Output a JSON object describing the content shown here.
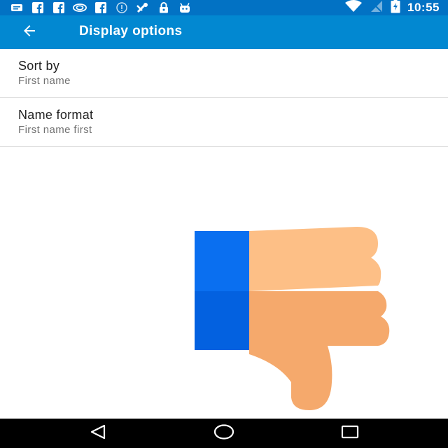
{
  "status_bar": {
    "time": "10:55",
    "left_icons": [
      "message-icon",
      "facebook-icon",
      "facebook-icon",
      "nvidia-icon",
      "facebook-icon",
      "info-icon",
      "no-sign-icon",
      "lock-icon",
      "android-icon"
    ],
    "right_icons": [
      "wifi-icon",
      "signal-icon",
      "battery-charging-icon"
    ]
  },
  "app_bar": {
    "title": "Display options",
    "back_icon": "arrow-back-icon"
  },
  "settings": [
    {
      "title": "Sort by",
      "summary": "First name"
    },
    {
      "title": "Name format",
      "summary": "First name first"
    }
  ],
  "overlay": {
    "icon": "thumbs-down-icon"
  },
  "nav_bar": {
    "icons": [
      "back-triangle-icon",
      "home-circle-icon",
      "recents-square-icon"
    ]
  },
  "colors": {
    "status_bar": "#0272c4",
    "app_bar": "#0288d1",
    "title_text": "#212121",
    "summary_text": "#707070",
    "thumb_cuff": "#0a6ff0",
    "thumb_skin": "#fdbf86"
  }
}
